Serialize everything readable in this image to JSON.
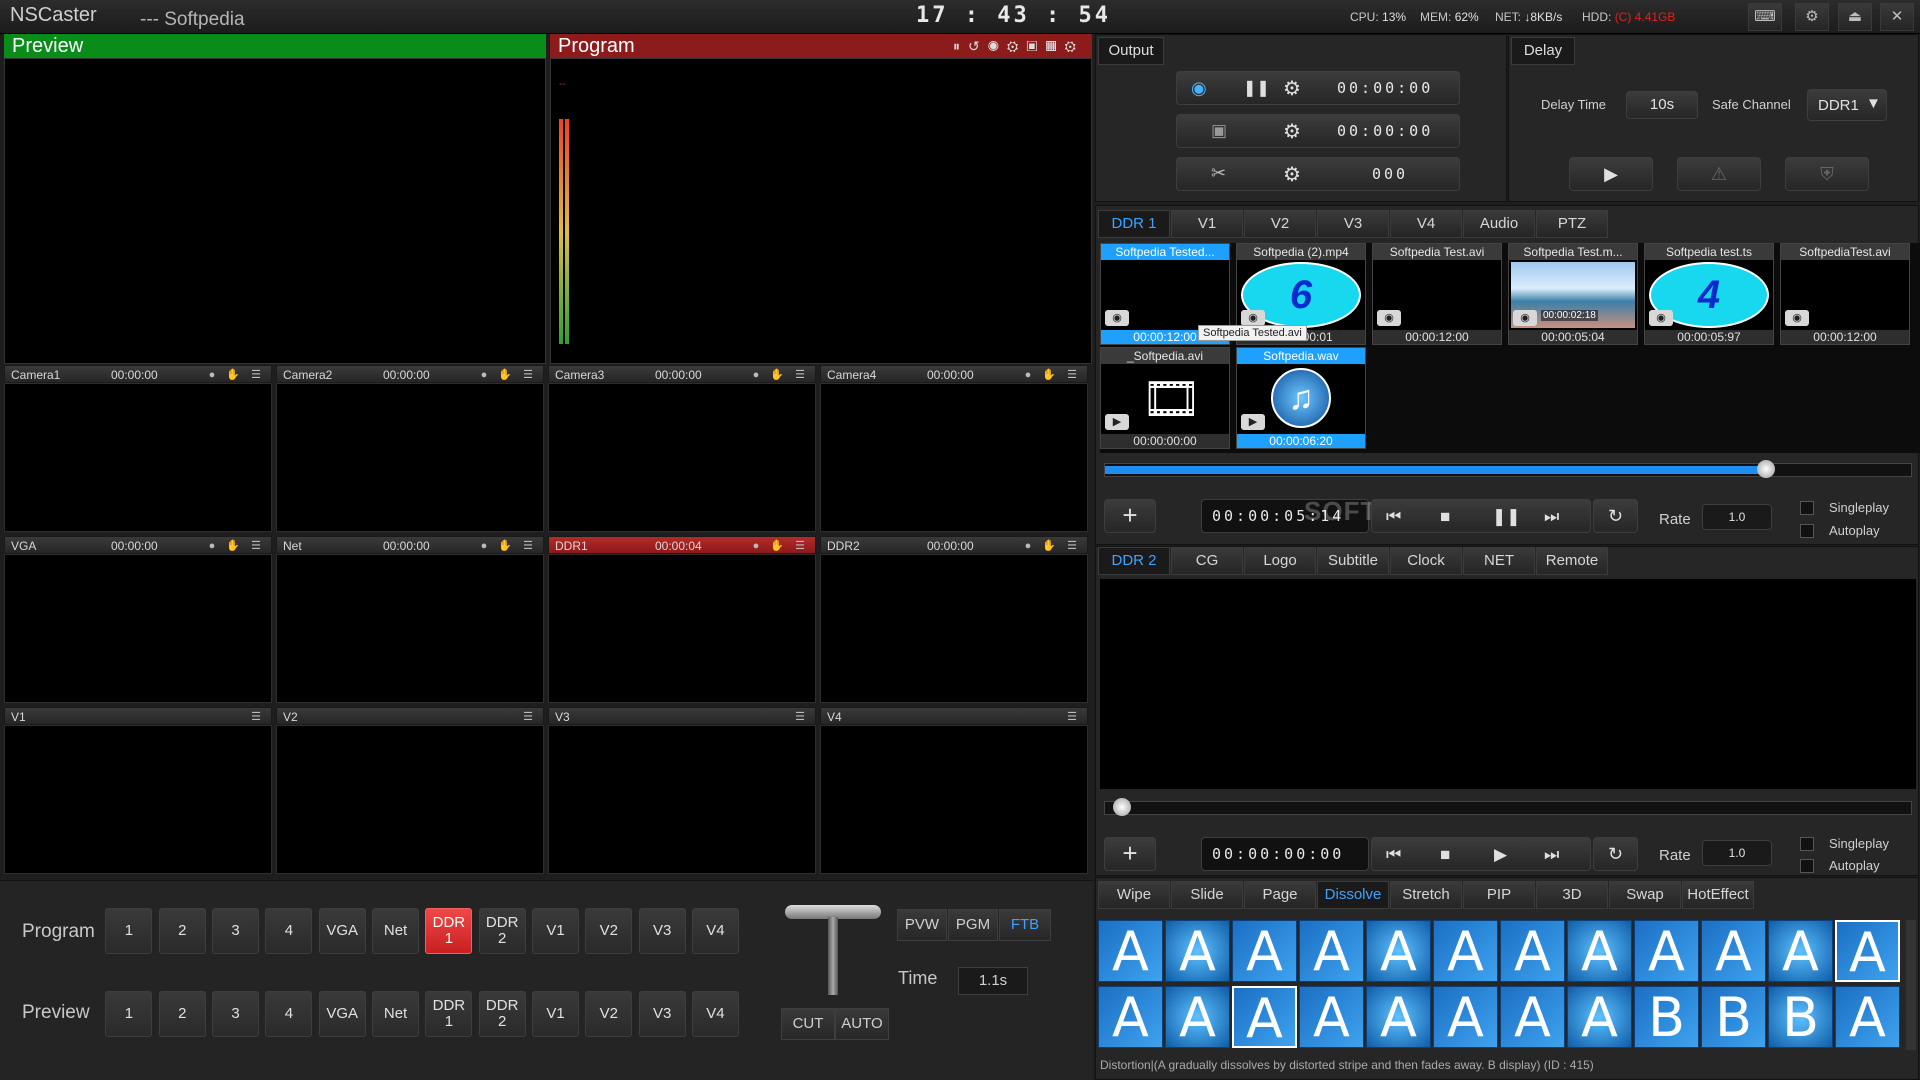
{
  "title_bar": {
    "app_name": "NSCaster",
    "subtitle": "--- Softpedia",
    "clock": "17 : 43 : 54",
    "cpu_label": "CPU:",
    "cpu": "13%",
    "mem_label": "MEM:",
    "mem": "62%",
    "net_label": "NET:",
    "net": "↓8KB/s",
    "hdd_label": "HDD:",
    "hdd": "(C) 4.41GB"
  },
  "preview": {
    "label": "Preview"
  },
  "program": {
    "label": "Program",
    "audio_marker": "--"
  },
  "multiview": [
    {
      "name": "Camera1",
      "time": "00:00:00"
    },
    {
      "name": "Camera2",
      "time": "00:00:00"
    },
    {
      "name": "Camera3",
      "time": "00:00:00"
    },
    {
      "name": "Camera4",
      "time": "00:00:00"
    },
    {
      "name": "VGA",
      "time": "00:00:00"
    },
    {
      "name": "Net",
      "time": "00:00:00"
    },
    {
      "name": "DDR1",
      "time": "00:00:04"
    },
    {
      "name": "DDR2",
      "time": "00:00:00"
    },
    {
      "name": "V1",
      "time": ""
    },
    {
      "name": "V2",
      "time": ""
    },
    {
      "name": "V3",
      "time": ""
    },
    {
      "name": "V4",
      "time": ""
    }
  ],
  "switcher": {
    "program_label": "Program",
    "preview_label": "Preview",
    "buttons": [
      "1",
      "2",
      "3",
      "4",
      "VGA",
      "Net",
      "DDR\n1",
      "DDR\n2",
      "V1",
      "V2",
      "V3",
      "V4"
    ],
    "program_active": "DDR\n1",
    "pvw": "PVW",
    "pgm": "PGM",
    "ftb": "FTB",
    "time_label": "Time",
    "time_value": "1.1s",
    "cut": "CUT",
    "auto": "AUTO"
  },
  "output": {
    "tab": "Output",
    "record_timer": "00:00:00",
    "stream_timer": "00:00:00",
    "clip_counter": "000"
  },
  "delay": {
    "tab": "Delay",
    "delay_time_label": "Delay Time",
    "delay_time_value": "10s",
    "safe_channel_label": "Safe Channel",
    "safe_channel_value": "DDR1"
  },
  "ddr1": {
    "tabs": [
      "DDR 1",
      "V1",
      "V2",
      "V3",
      "V4",
      "Audio",
      "PTZ"
    ],
    "clips": [
      {
        "name": "Softpedia Tested...",
        "time": "00:00:12:00"
      },
      {
        "name": "Softpedia (2).mp4",
        "time": "00:00:00:01"
      },
      {
        "name": "Softpedia Test.avi",
        "time": "00:00:12:00"
      },
      {
        "name": "Softpedia Test.m...",
        "time": "00:00:05:04"
      },
      {
        "name": "Softpedia test.ts",
        "time": "00:00:05:97"
      },
      {
        "name": "SoftpediaTest.avi",
        "time": "00:00:12:00"
      },
      {
        "name": "_Softpedia.avi",
        "time": "00:00:00:00"
      },
      {
        "name": "Softpedia.wav",
        "time": "00:00:06:20"
      }
    ],
    "tooltip": "Softpedia Tested.avi",
    "overlay_time": "00:00:02:18",
    "digit_a": "6",
    "digit_b": "4",
    "progress": 0.82,
    "timecode": "00:00:05:14",
    "rate_label": "Rate",
    "rate_value": "1.0",
    "singleplay": "Singleplay",
    "autoplay": "Autoplay",
    "watermark": "SOFTPEDIA"
  },
  "ddr2": {
    "tabs": [
      "DDR 2",
      "CG",
      "Logo",
      "Subtitle",
      "Clock",
      "NET",
      "Remote"
    ],
    "timecode": "00:00:00:00",
    "rate_label": "Rate",
    "rate_value": "1.0",
    "singleplay": "Singleplay",
    "autoplay": "Autoplay",
    "progress": 0.01
  },
  "effects": {
    "tabs": [
      "Wipe",
      "Slide",
      "Page",
      "Dissolve",
      "Stretch",
      "PIP",
      "3D",
      "Swap",
      "HotEffect"
    ],
    "active_tab": "Dissolve",
    "tile_letters": [
      "A",
      "A",
      "A",
      "A",
      "A",
      "A",
      "A",
      "A",
      "A",
      "A",
      "A",
      "A",
      "A",
      "A",
      "A",
      "A",
      "A",
      "A",
      "A",
      "A",
      "B",
      "B",
      "B",
      "A"
    ],
    "status": "Distortion|(A gradually dissolves by distorted stripe and then fades away. B display) (ID : 415)"
  },
  "colors": {
    "preview_green": "#0a8c1a",
    "program_red": "#8c1c1c",
    "accent_blue": "#3fa2ff",
    "live_red": "#c82020"
  }
}
